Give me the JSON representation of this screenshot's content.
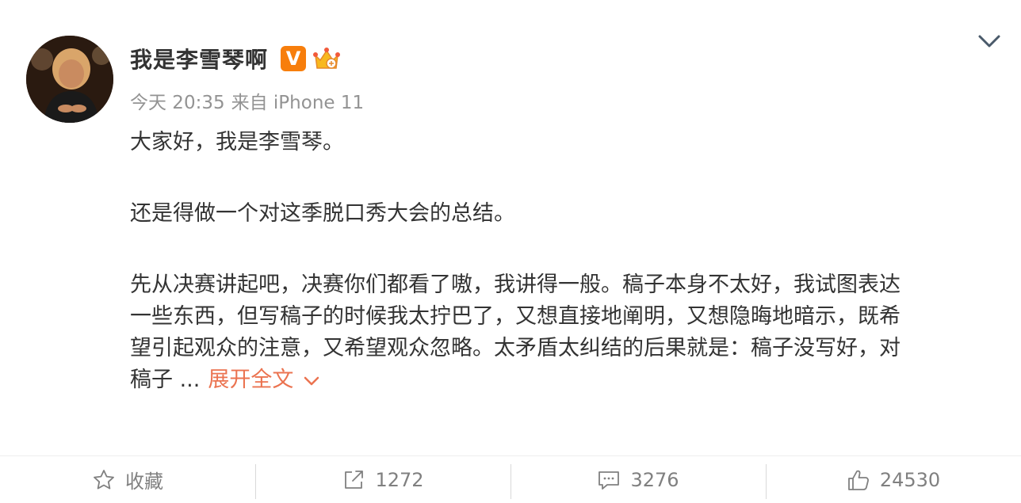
{
  "user": {
    "name": "我是李雪琴啊",
    "verified_badge": "V"
  },
  "meta": {
    "time": "今天 20:35",
    "source": "来自 iPhone 11"
  },
  "content": {
    "para1": "大家好，我是李雪琴。",
    "para2": "还是得做一个对这季脱口秀大会的总结。",
    "para3_lines": [
      "先从决赛讲起吧，决赛你们都看了嗷，我讲得一般。稿子本身不太好，我试图表达",
      "一些东西，但写稿子的时候我太拧巴了，又想直接地阐明，又想隐晦地暗示，既希",
      "望引起观众的注意，又希望观众忽略。太矛盾太纠结的后果就是：稿子没写好，对"
    ],
    "para3_last": "稿子 ...",
    "expand_label": "展开全文"
  },
  "actions": {
    "favorite_label": "收藏",
    "repost_count": "1272",
    "comment_count": "3276",
    "like_count": "24530"
  },
  "colors": {
    "expand_link": "#eb7350",
    "verified_badge": "#f77e0c",
    "meta_text": "#939393"
  }
}
